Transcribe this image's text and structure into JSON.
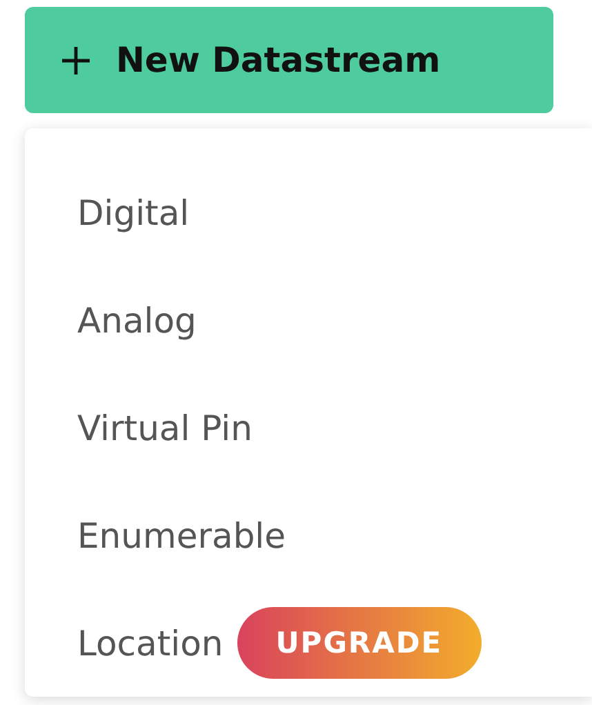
{
  "new_button": {
    "label": "New Datastream"
  },
  "menu": {
    "items": [
      {
        "label": "Digital"
      },
      {
        "label": "Analog"
      },
      {
        "label": "Virtual Pin"
      },
      {
        "label": "Enumerable"
      },
      {
        "label": "Location",
        "badge": "UPGRADE"
      }
    ]
  }
}
